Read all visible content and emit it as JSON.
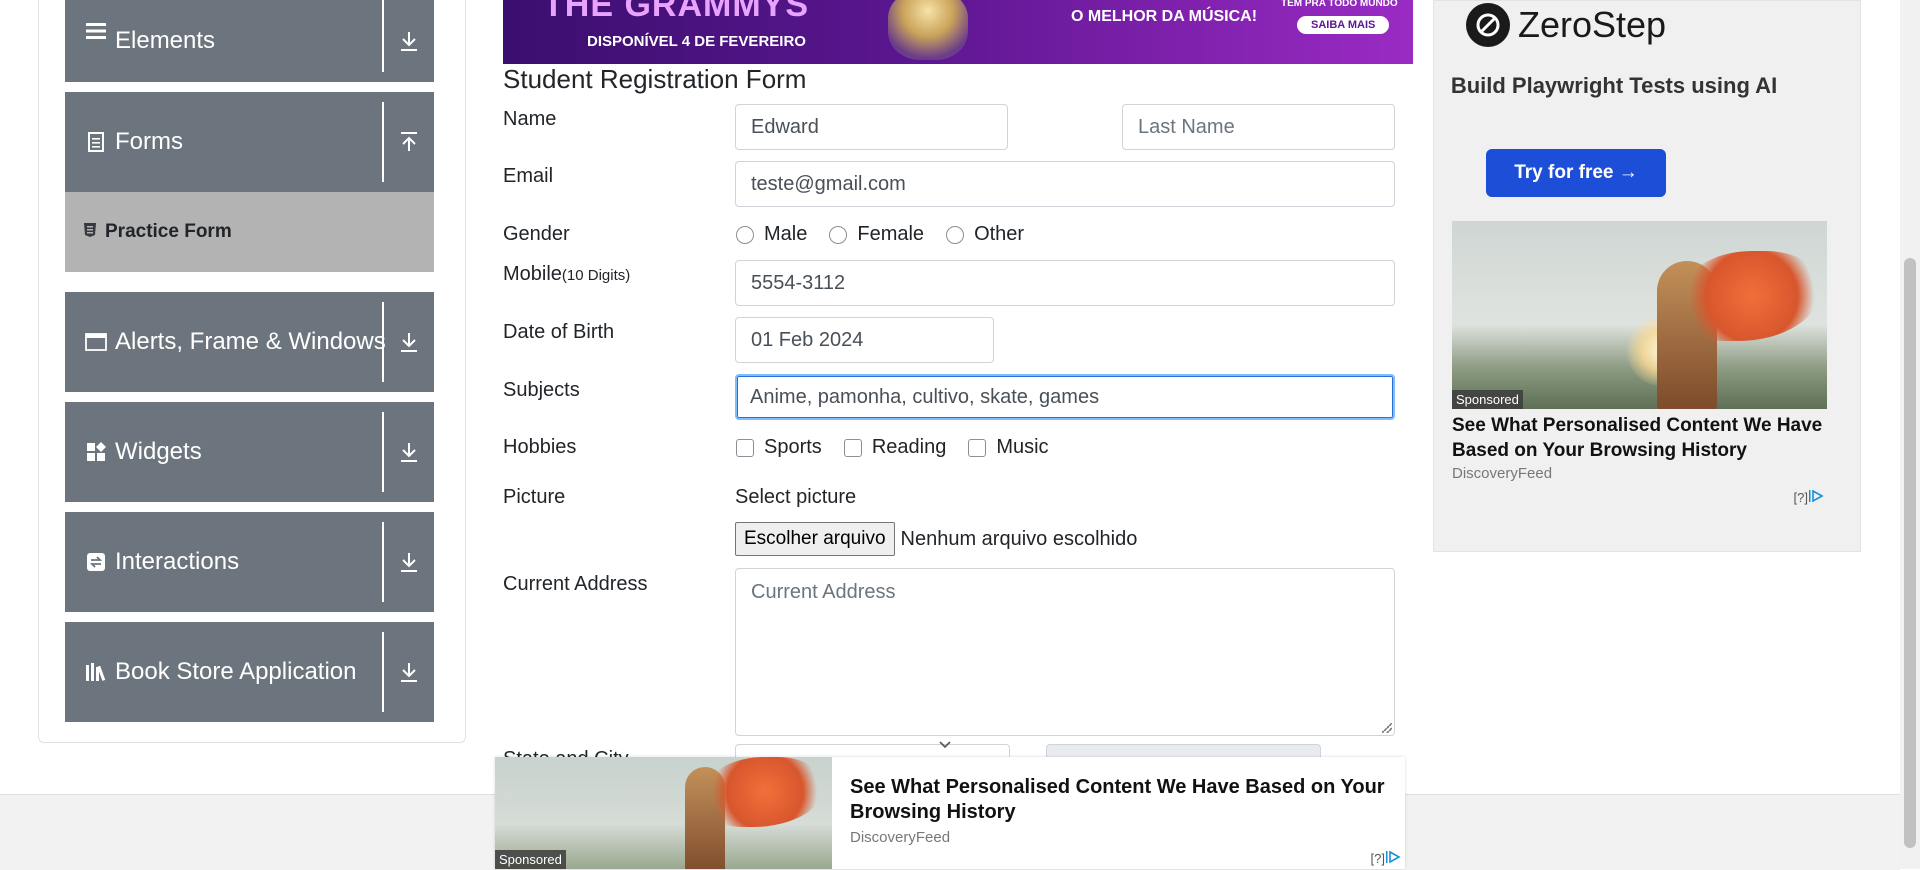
{
  "sidebar": {
    "groups": [
      {
        "label": "Elements",
        "icon": "list-icon",
        "arrow": "download-arrow-icon"
      },
      {
        "label": "Forms",
        "icon": "document-icon",
        "arrow": "upload-arrow-icon"
      },
      {
        "label": "Alerts, Frame & Windows",
        "icon": "window-icon",
        "arrow": "download-arrow-icon"
      },
      {
        "label": "Widgets",
        "icon": "widgets-icon",
        "arrow": "download-arrow-icon"
      },
      {
        "label": "Interactions",
        "icon": "interactions-icon",
        "arrow": "download-arrow-icon"
      },
      {
        "label": "Book Store Application",
        "icon": "books-icon",
        "arrow": "download-arrow-icon"
      }
    ],
    "active_item": "Practice Form"
  },
  "top_banner": {
    "title": "THE GRAMMYS",
    "date_text": "DISPONÍVEL 4 DE FEVEREIRO",
    "tagline": "O MELHOR DA MÚSICA!",
    "top_right": "TEM PRA TODO MUNDO",
    "cta": "SAIBA MAIS"
  },
  "form": {
    "title": "Student Registration Form",
    "name_label": "Name",
    "first_name_value": "Edward",
    "last_name_placeholder": "Last Name",
    "email_label": "Email",
    "email_value": "teste@gmail.com",
    "gender_label": "Gender",
    "gender_options": [
      "Male",
      "Female",
      "Other"
    ],
    "mobile_label": "Mobile",
    "mobile_hint": "(10 Digits)",
    "mobile_value": "5554-3112",
    "dob_label": "Date of Birth",
    "dob_value": "01 Feb 2024",
    "subjects_label": "Subjects",
    "subjects_value": "Anime, pamonha, cultivo, skate, games",
    "hobbies_label": "Hobbies",
    "hobby_options": [
      "Sports",
      "Reading",
      "Music"
    ],
    "picture_label": "Picture",
    "select_picture": "Select picture",
    "file_button": "Escolher arquivo",
    "file_status": "Nenhum arquivo escolhido",
    "address_label": "Current Address",
    "address_placeholder": "Current Address",
    "state_city_label": "State and City"
  },
  "right_ad": {
    "brand": "ZeroStep",
    "tagline": "Build Playwright Tests using AI",
    "cta": "Try for free →",
    "sponsored": "Sponsored",
    "headline": "See What Personalised Content We Have Based on Your Browsing History",
    "source": "DiscoveryFeed",
    "info": "[?]"
  },
  "bottom_ad": {
    "sponsored": "Sponsored",
    "headline": "See What Personalised Content We Have Based on Your Browsing History",
    "source": "DiscoveryFeed",
    "info": "[?]"
  },
  "colors": {
    "sidebar_header": "#6c757d",
    "active_item_bg": "#b3b3b3",
    "focus_border": "#80bdff",
    "cta_blue": "#1d4ed8"
  }
}
